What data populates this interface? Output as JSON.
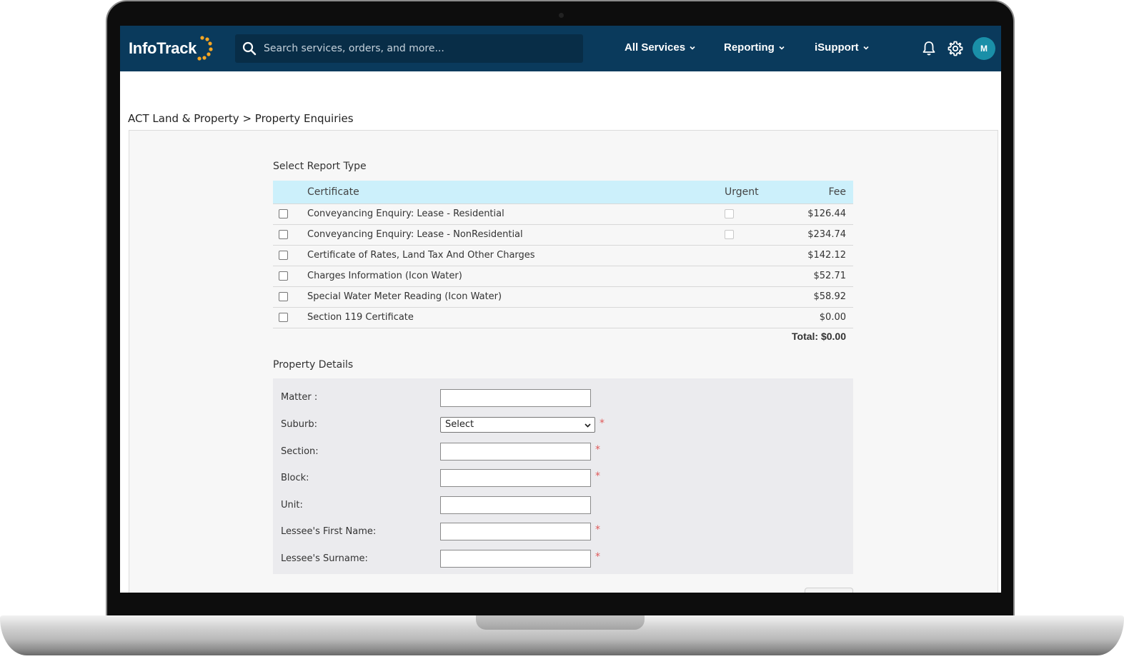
{
  "header": {
    "logo_text": "InfoTrack",
    "search_placeholder": "Search services, orders, and more...",
    "nav": [
      "All Services",
      "Reporting",
      "iSupport"
    ],
    "avatar_initial": "M"
  },
  "breadcrumb": "ACT Land & Property > Property Enquiries",
  "report_type": {
    "title": "Select Report Type",
    "columns": {
      "certificate": "Certificate",
      "urgent": "Urgent",
      "fee": "Fee"
    },
    "rows": [
      {
        "name": "Conveyancing Enquiry: Lease - Residential",
        "urgent_option": true,
        "fee": "$126.44"
      },
      {
        "name": "Conveyancing Enquiry: Lease - NonResidential",
        "urgent_option": true,
        "fee": "$234.74"
      },
      {
        "name": "Certificate of Rates, Land Tax And Other Charges",
        "urgent_option": false,
        "fee": "$142.12"
      },
      {
        "name": "Charges Information (Icon Water)",
        "urgent_option": false,
        "fee": "$52.71"
      },
      {
        "name": "Special Water Meter Reading (Icon Water)",
        "urgent_option": false,
        "fee": "$58.92"
      },
      {
        "name": "Section 119 Certificate",
        "urgent_option": false,
        "fee": "$0.00"
      }
    ],
    "total": "Total: $0.00"
  },
  "property_details": {
    "title": "Property Details",
    "fields": {
      "matter": "Matter :",
      "suburb": "Suburb:",
      "section": "Section:",
      "block": "Block:",
      "unit": "Unit:",
      "first_name": "Lessee's First Name:",
      "surname": "Lessee's Surname:"
    },
    "suburb_selected": "Select",
    "required_mark": "*"
  },
  "colors": {
    "header_bg": "#0a3a5c",
    "table_header_bg": "#ccf0fb",
    "logo_accent": "#f5a623",
    "avatar_bg": "#1a8fa8",
    "required": "#e05a5a"
  },
  "icons": [
    "search-icon",
    "chevron-down-icon",
    "bell-icon",
    "gear-icon"
  ]
}
